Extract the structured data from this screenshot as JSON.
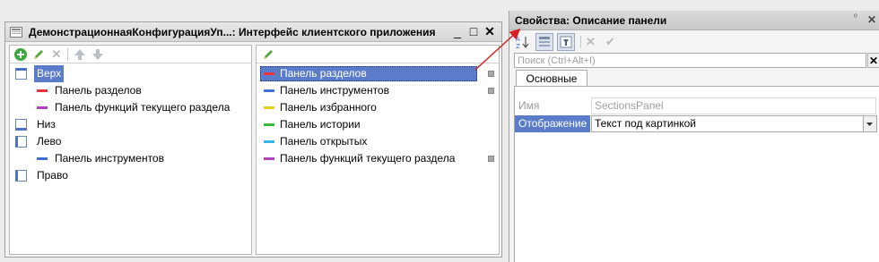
{
  "left_window": {
    "title": "ДемонстрационнаяКонфигурацияУп...: Интерфейс клиентского приложения",
    "buttons": {
      "minimize": "_",
      "maximize": "□",
      "close": "✕"
    },
    "left_pane": {
      "items": [
        {
          "label": "Верх",
          "kind": "panel",
          "selected": true
        },
        {
          "label": "Панель разделов",
          "kind": "bar",
          "color": "#e8323c"
        },
        {
          "label": "Панель функций текущего раздела",
          "kind": "bar",
          "color": "#b040c0"
        },
        {
          "label": "Низ",
          "kind": "panel"
        },
        {
          "label": "Лево",
          "kind": "panel"
        },
        {
          "label": "Панель инструментов",
          "kind": "bar",
          "color": "#3d6fd6"
        },
        {
          "label": "Право",
          "kind": "panel"
        }
      ]
    },
    "right_pane": {
      "items": [
        {
          "label": "Панель разделов",
          "color": "#e8323c",
          "selected": true,
          "check": true
        },
        {
          "label": "Панель инструментов",
          "color": "#3d6fd6",
          "check": true
        },
        {
          "label": "Панель избранного",
          "color": "#e6d21e",
          "check": false
        },
        {
          "label": "Панель истории",
          "color": "#3cb83c",
          "check": false
        },
        {
          "label": "Панель открытых",
          "color": "#35b6e6",
          "check": false
        },
        {
          "label": "Панель функций текущего раздела",
          "color": "#b040c0",
          "check": true
        }
      ]
    }
  },
  "properties_window": {
    "title": "Свойства: Описание панели",
    "pin": "ᵒ",
    "close": "✕",
    "search_placeholder": "Поиск (Ctrl+Alt+I)",
    "search_clear": "✕",
    "tab": "Основные",
    "rows": {
      "name_label": "Имя",
      "name_value": "SectionsPanel",
      "display_label": "Отображение",
      "display_value": "Текст под картинкой"
    }
  },
  "colors": {
    "selection": "#5b7cc9",
    "arrow": "#d42020"
  }
}
